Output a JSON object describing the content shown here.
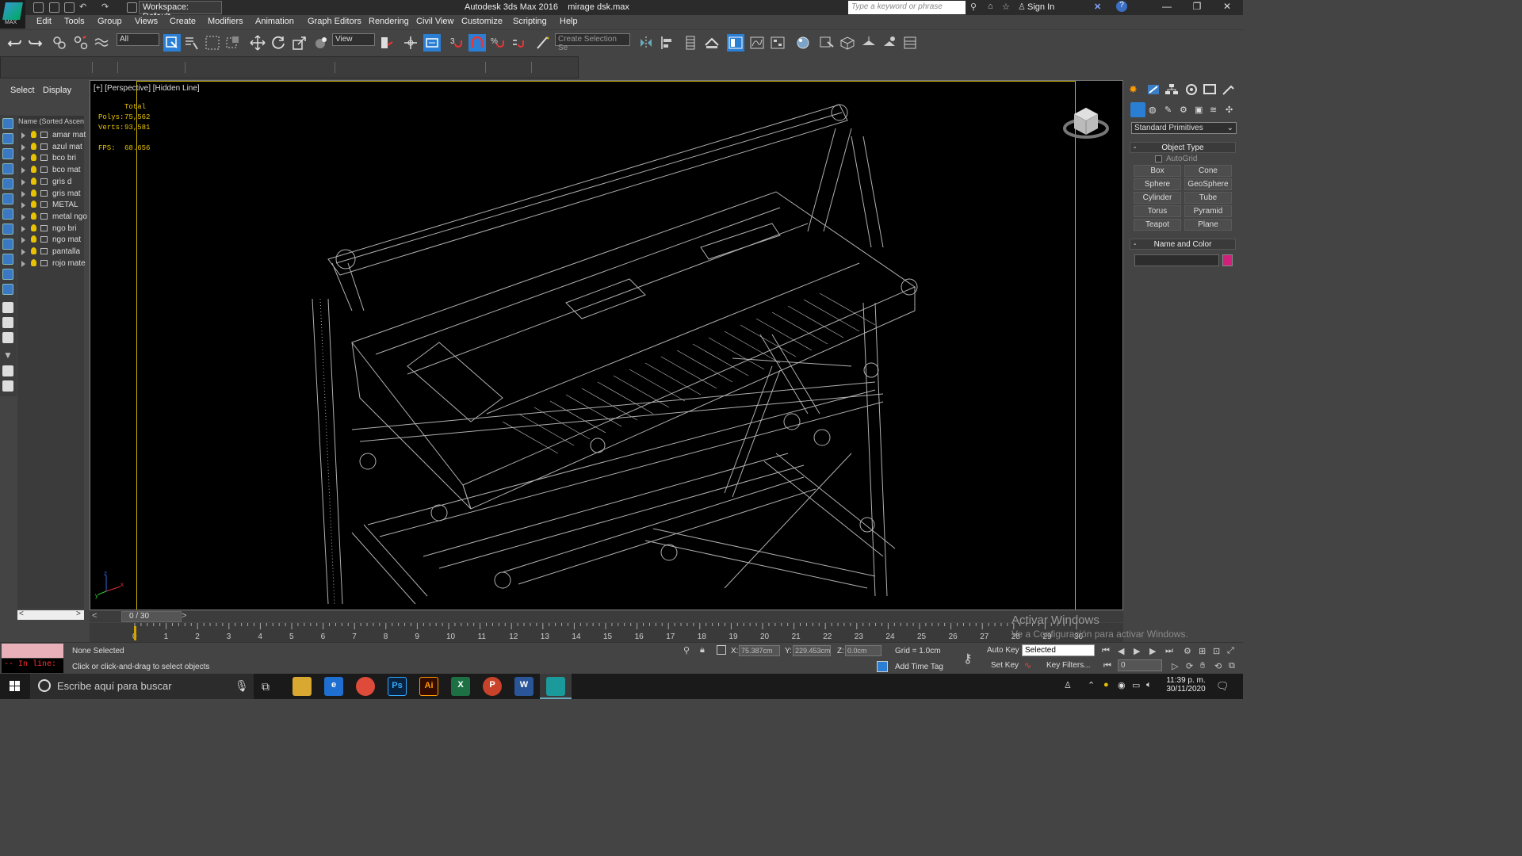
{
  "titlebar": {
    "workspace": "Workspace: Default",
    "app_title": "Autodesk 3ds Max 2016",
    "file_name": "mirage dsk.max",
    "search_placeholder": "Type a keyword or phrase",
    "sign_in": "Sign In",
    "logo_text": "MAX"
  },
  "menu": [
    "Edit",
    "Tools",
    "Group",
    "Views",
    "Create",
    "Modifiers",
    "Animation",
    "Graph Editors",
    "Rendering",
    "Civil View",
    "Customize",
    "Scripting",
    "Help"
  ],
  "toolbar": {
    "selection_filter": "All",
    "ref_coord": "View",
    "named_selection": "Create Selection Se",
    "snap_labels": [
      "3",
      "%"
    ]
  },
  "explorer": {
    "tabs": [
      "Select",
      "Display"
    ],
    "column_header": "Name (Sorted Ascen",
    "items": [
      "amar mat",
      "azul mat",
      "bco bri",
      "bco mat",
      "gris d",
      "gris mat",
      "METAL",
      "metal ngo",
      "ngo bri",
      "ngo mat",
      "pantalla",
      "rojo mate"
    ]
  },
  "viewport": {
    "label": "[+] [Perspective] [Hidden Line]",
    "stats_header": "Total",
    "polys_label": "Polys:",
    "polys_value": "75,562",
    "verts_label": "Verts:",
    "verts_value": "93,581",
    "fps_label": "FPS:",
    "fps_value": "68.656",
    "axis_labels": [
      "x",
      "y",
      "z"
    ]
  },
  "watermark": {
    "line1": "Activar Windows",
    "line2": "Ve a Configuración para activar Windows."
  },
  "command_panel": {
    "category": "Standard Primitives",
    "object_type_title": "Object Type",
    "autogrid": "AutoGrid",
    "primitives": [
      "Box",
      "Cone",
      "Sphere",
      "GeoSphere",
      "Cylinder",
      "Tube",
      "Torus",
      "Pyramid",
      "Teapot",
      "Plane"
    ],
    "name_color_title": "Name and Color",
    "object_color": "#d1207c"
  },
  "timeline": {
    "slider_label": "0 / 30",
    "ticks": [
      "0",
      "1",
      "2",
      "3",
      "4",
      "5",
      "6",
      "7",
      "8",
      "9",
      "10",
      "11",
      "12",
      "13",
      "14",
      "15",
      "16",
      "17",
      "18",
      "19",
      "20",
      "21",
      "22",
      "23",
      "24",
      "25",
      "26",
      "27",
      "28",
      "29",
      "30"
    ],
    "current_frame": 0,
    "total_frames": 30
  },
  "status": {
    "inline_label": "-- In line:",
    "selection": "None Selected",
    "prompt": "Click or click-and-drag to select objects",
    "x_label": "X:",
    "x_value": "75.387cm",
    "y_label": "Y:",
    "y_value": "229.453cm",
    "z_label": "Z:",
    "z_value": "0.0cm",
    "grid": "Grid = 1.0cm",
    "add_time_tag": "Add Time Tag",
    "auto_key": "Auto Key",
    "set_key": "Set Key",
    "selected_dd": "Selected",
    "key_filters": "Key Filters...",
    "frame_value": "0"
  },
  "taskbar": {
    "search_placeholder": "Escribe aquí para buscar",
    "apps": [
      {
        "name": "explorer",
        "label": ""
      },
      {
        "name": "edge",
        "label": "e"
      },
      {
        "name": "chrome",
        "label": ""
      },
      {
        "name": "photoshop",
        "label": "Ps"
      },
      {
        "name": "illustrator",
        "label": "Ai"
      },
      {
        "name": "excel",
        "label": "X"
      },
      {
        "name": "powerpoint",
        "label": "P"
      },
      {
        "name": "word",
        "label": "W"
      },
      {
        "name": "3dsmax",
        "label": ""
      }
    ],
    "time": "11:39 p. m.",
    "date": "30/11/2020"
  },
  "colors": {
    "accent": "#2a7fd4",
    "stats_text": "#e8c200",
    "safe_frame": "#c8b400"
  }
}
